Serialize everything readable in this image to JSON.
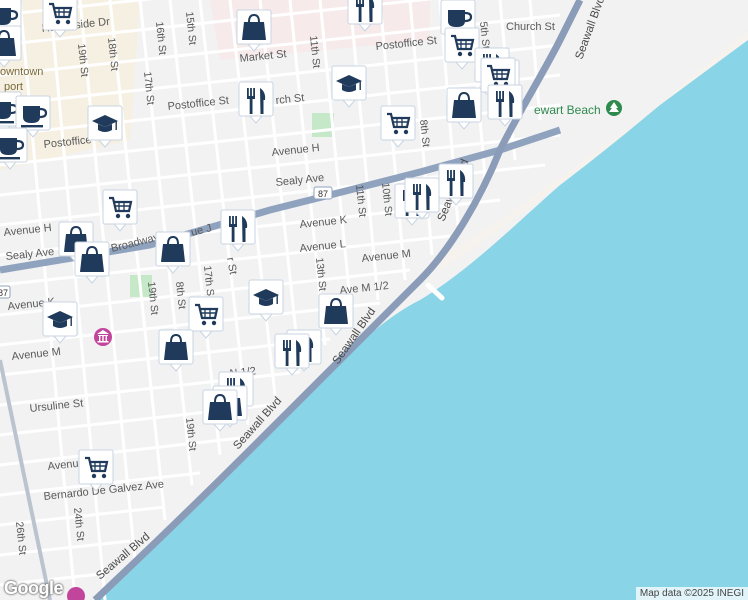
{
  "streets": {
    "harborside": "Harborside Dr",
    "church": "Church St",
    "postoffice_east": "Postoffice St",
    "postoffice_mid": "Postoffice St",
    "postoffice_west": "Postoffice",
    "market": "Market St",
    "church_mid": "rch St",
    "avenue_h": "Avenue H",
    "avenue_h_west": "Avenue H",
    "sealy": "Sealy Ave",
    "sealy_west": "Sealy Ave",
    "avenue_k": "Avenue K",
    "avenue_l": "Avenue L",
    "avenue_m": "Avenue M",
    "ave_m_half": "Ave M 1/2",
    "broadway": "Broadway",
    "ue_j": "ue J",
    "avenue_m_west": "Avenue M",
    "n_half": "N 1/2",
    "ursuline": "Ursuline St",
    "avenue_west": "Avenue",
    "bernardo": "Bernardo De Galvez Ave",
    "seawall_1": "Seawall Blvd",
    "seawall_2": "Seawall Blvd",
    "seawall_3": "Seawall Blvd",
    "seawall_4": "Seawall Blvd",
    "seawall_5": "Seawall Blvd",
    "st_19_top": "19th St",
    "st_18_top": "18th St",
    "st_16": "16th St",
    "st_15": "15th St",
    "st_17": "17th St",
    "st_11_top": "11th St",
    "st_8": "8th St",
    "st_5": "5th St",
    "st_11": "11th St",
    "st_10": "10th St",
    "st_13": "13th St",
    "st_19": "19th St",
    "st_18": "8th St",
    "st_17_mid": "17th S",
    "st_19_low": "19th St",
    "st_24": "24th St",
    "st_26": "26th St",
    "ne": "E",
    "k_west": "Avenue K",
    "r_label": "r St"
  },
  "places": {
    "downtown": "owntown",
    "port": "port",
    "stewart_beach": "ewart Beach"
  },
  "route_shield": "87",
  "route_shield_west": "87",
  "pins": [
    {
      "name": "shopping-cart-pin",
      "icon": "cart"
    },
    {
      "name": "shopping-bag-pin",
      "icon": "bag"
    },
    {
      "name": "restaurant-pin",
      "icon": "fork"
    },
    {
      "name": "cafe-pin",
      "icon": "cup"
    },
    {
      "name": "school-pin",
      "icon": "school"
    },
    {
      "name": "museum-pin",
      "icon": "museum"
    },
    {
      "name": "park-pin",
      "icon": "tree"
    }
  ],
  "colors": {
    "water": "#89d4e6",
    "land": "#f2f2f2",
    "highway": "#8fa3bf",
    "seawall": "#8a9cb8",
    "pin": "#1f3a5a",
    "park": "#c5e8c8"
  },
  "logo": "Google",
  "attribution": "Map data ©2025 INEGI"
}
